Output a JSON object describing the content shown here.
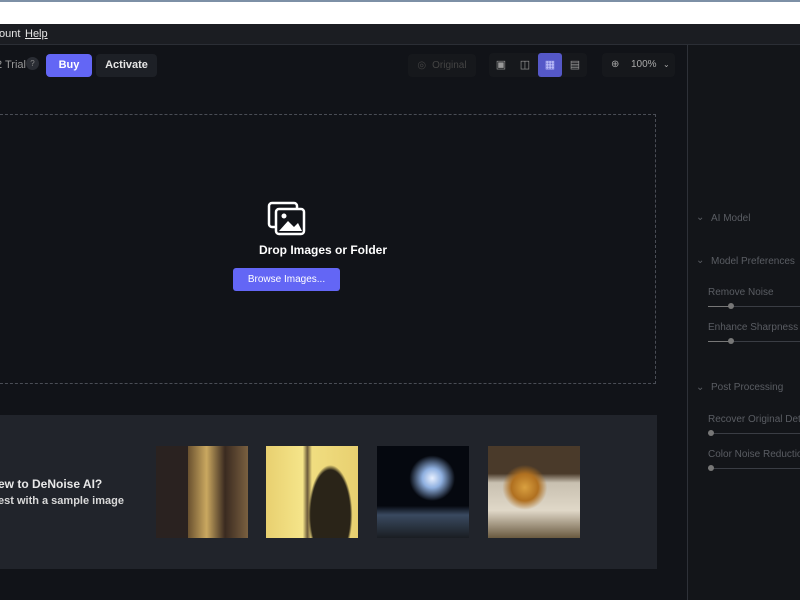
{
  "menu": {
    "items": [
      "ount",
      "Help"
    ]
  },
  "toolbar": {
    "trial": "2 Trial",
    "help": "?",
    "buy": "Buy",
    "activate": "Activate",
    "original": "Original",
    "zoom": "100%",
    "view_modes": [
      "single",
      "split",
      "side-by-side",
      "grid"
    ],
    "active_view": "side-by-side"
  },
  "dropzone": {
    "title": "Drop Images or Folder",
    "browse": "Browse Images..."
  },
  "samples": {
    "heading": "ew to DeNoise AI?",
    "subheading": "est with a sample image",
    "images": [
      "interior-lantern",
      "stained-glass-silhouette",
      "fireworks-night",
      "hanging-baskets"
    ]
  },
  "panel": {
    "ai_model": "AI Model",
    "model_prefs": "Model Preferences",
    "remove_noise": "Remove Noise",
    "enhance_sharpness": "Enhance Sharpness",
    "post_processing": "Post Processing",
    "recover_detail": "Recover Original Deta",
    "color_noise": "Color Noise Reductio"
  },
  "sliders": {
    "remove_noise": 0.2,
    "enhance_sharpness": 0.2,
    "recover_detail": 0,
    "color_noise": 0
  },
  "colors": {
    "accent": "#6366f5",
    "active_view": "#5558c8"
  }
}
